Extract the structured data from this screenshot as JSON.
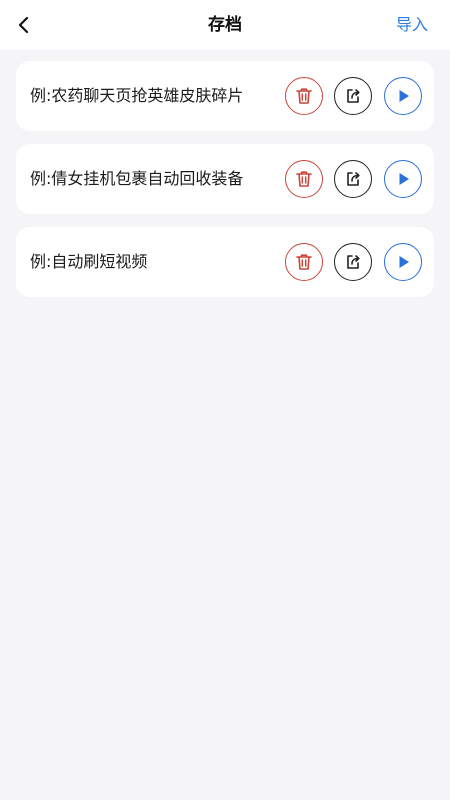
{
  "header": {
    "title": "存档",
    "import_label": "导入"
  },
  "colors": {
    "accent": "#2f7bd9",
    "delete": "#c9473a",
    "play": "#2b6fd8",
    "background": "#f5f5f7"
  },
  "icons": {
    "back": "chevron-left-icon",
    "delete": "trash-icon",
    "share": "share-icon",
    "play": "play-icon"
  },
  "items": [
    {
      "label": "例:农药聊天页抢英雄皮肤碎片"
    },
    {
      "label": "例:倩女挂机包裹自动回收装备"
    },
    {
      "label": "例:自动刷短视频"
    }
  ]
}
